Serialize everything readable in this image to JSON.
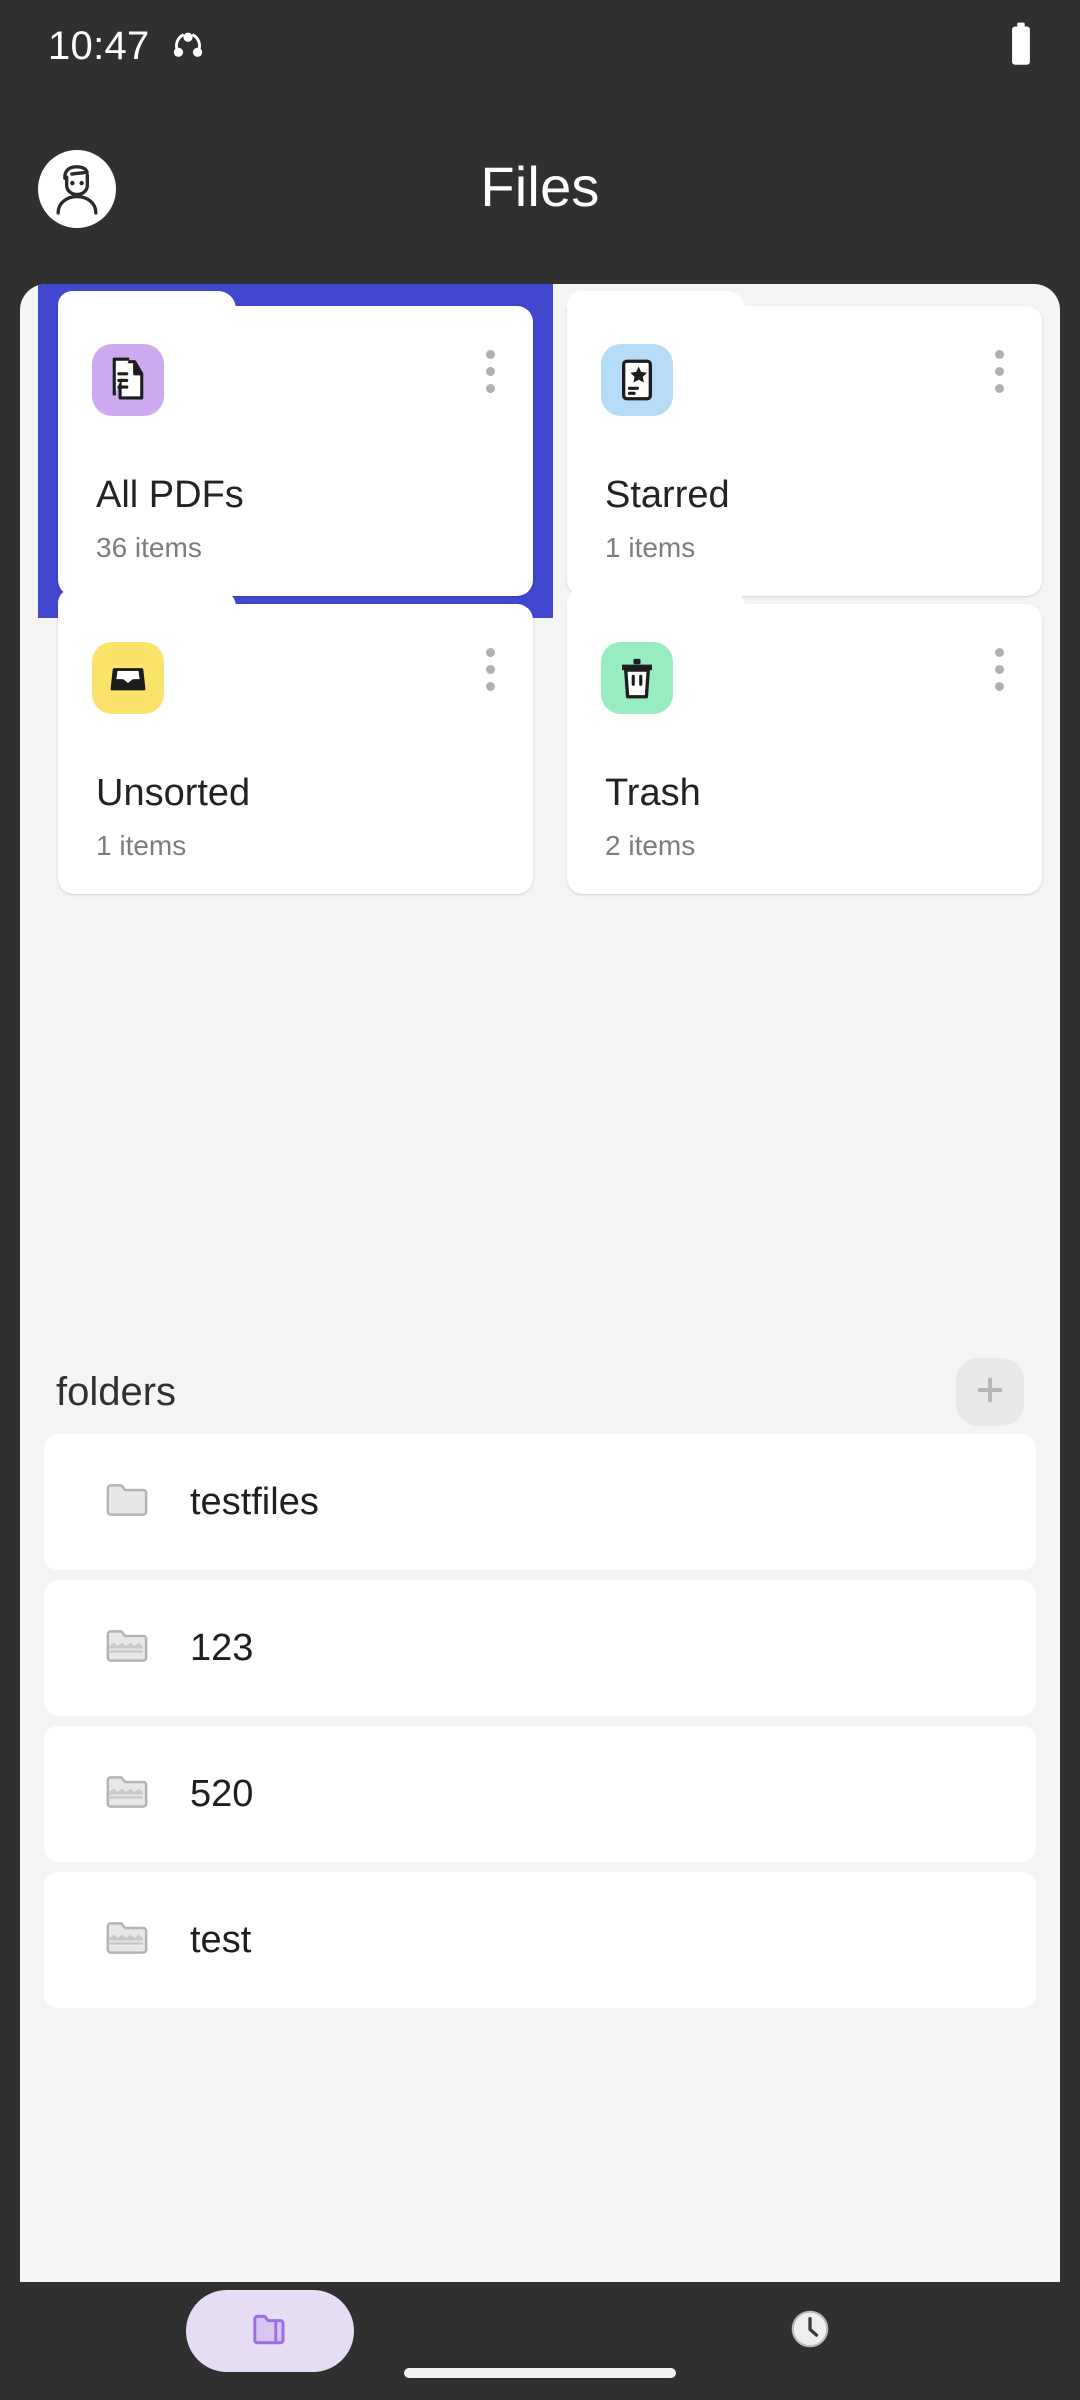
{
  "status_bar": {
    "time": "10:47",
    "icons": [
      "share-sync-icon",
      "battery-icon"
    ]
  },
  "app_bar": {
    "title": "Files",
    "avatar_icon": "user-avatar-icon"
  },
  "shortcuts": [
    {
      "title": "All PDFs",
      "count": "36 items",
      "icon": "documents-stack-icon",
      "icon_bg": "#cdaaf0",
      "selected": true
    },
    {
      "title": "Starred",
      "count": "1 items",
      "icon": "starred-document-icon",
      "icon_bg": "#b6dcf7",
      "selected": false
    },
    {
      "title": "Unsorted",
      "count": "1 items",
      "icon": "inbox-tray-icon",
      "icon_bg": "#fae26b",
      "selected": false
    },
    {
      "title": "Trash",
      "count": "2 items",
      "icon": "trash-bin-icon",
      "icon_bg": "#97ecc0",
      "selected": false
    }
  ],
  "folders_section": {
    "label": "folders",
    "add_button_icon": "plus-icon",
    "items": [
      {
        "name": "testfiles",
        "icon": "empty-folder-icon"
      },
      {
        "name": "123",
        "icon": "filled-folder-icon"
      },
      {
        "name": "520",
        "icon": "filled-folder-icon"
      },
      {
        "name": "test",
        "icon": "filled-folder-icon"
      }
    ]
  },
  "bottom_nav": {
    "items": [
      {
        "icon": "folder-icon",
        "active": true
      },
      {
        "icon": "clock-recent-icon",
        "active": false
      }
    ]
  },
  "colors": {
    "selection_blue": "#4147ce",
    "sheet_bg": "#f5f5f5",
    "system_bg": "#303030",
    "nav_active_pill": "#e6ddf5",
    "nav_active_icon": "#9b6fe0"
  }
}
